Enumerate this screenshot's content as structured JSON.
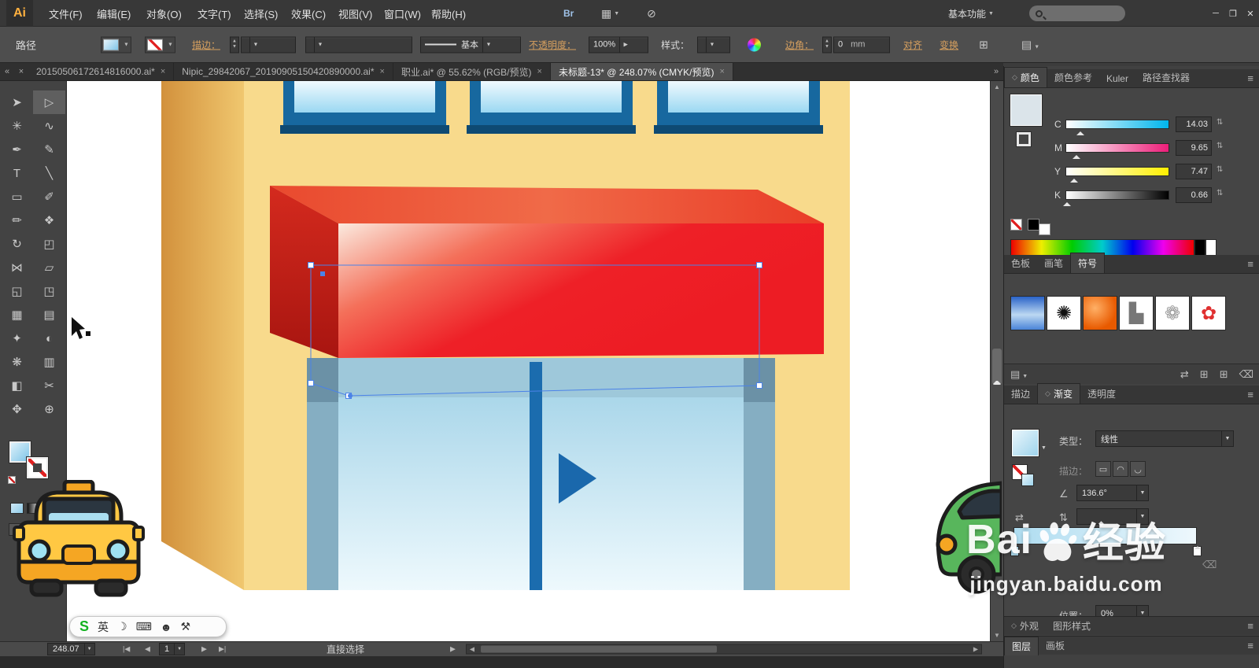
{
  "menubar": {
    "logo": "Ai",
    "items": [
      "文件(F)",
      "编辑(E)",
      "对象(O)",
      "文字(T)",
      "选择(S)",
      "效果(C)",
      "视图(V)",
      "窗口(W)",
      "帮助(H)"
    ],
    "bridge_label": "Br",
    "workspace_label": "基本功能"
  },
  "icons": {
    "dropdown": "▼",
    "close": "×",
    "menu": "≡",
    "collapse_left": "«",
    "overflow_right": "»",
    "minimize": "─",
    "restore": "❐",
    "window_close": "✕",
    "spin_up": "▲",
    "spin_down": "▼",
    "swap": "⇄",
    "angle": "∠",
    "aspect": "⇅",
    "diamond": "◆",
    "trash": "⌫",
    "library": "▤",
    "grid": "⊞",
    "gpu": "⊘",
    "arrange": "▦",
    "prev": "◀",
    "next": "▶",
    "first": "|◀",
    "last": "▶|",
    "panel_diamond": "◇"
  },
  "control_bar": {
    "selection_label": "路径",
    "stroke_link": "描边：",
    "stroke_style_value": "基本",
    "opacity_link": "不透明度：",
    "opacity_value": "100%",
    "style_label": "样式：",
    "corner_link": "边角：",
    "corner_value": "0",
    "corner_unit": "mm",
    "align_link": "对齐",
    "transform_link": "变换"
  },
  "document_tabs": [
    {
      "label": "20150506172614816000.ai*"
    },
    {
      "label": "Nipic_29842067_20190905150420890000.ai*"
    },
    {
      "label": "职业.ai* @ 55.62% (RGB/预览)"
    },
    {
      "label": "未标题-13* @ 248.07% (CMYK/预览)"
    }
  ],
  "tools": [
    {
      "name": "selection",
      "glyph": "➤"
    },
    {
      "name": "direct-selection",
      "glyph": "▷"
    },
    {
      "name": "magic-wand",
      "glyph": "✳"
    },
    {
      "name": "lasso",
      "glyph": "∿"
    },
    {
      "name": "pen",
      "glyph": "✒"
    },
    {
      "name": "curvature",
      "glyph": "✎"
    },
    {
      "name": "type",
      "glyph": "T"
    },
    {
      "name": "line-segment",
      "glyph": "╲"
    },
    {
      "name": "rectangle",
      "glyph": "▭"
    },
    {
      "name": "paintbrush",
      "glyph": "✐"
    },
    {
      "name": "pencil",
      "glyph": "✏"
    },
    {
      "name": "shaper",
      "glyph": "❖"
    },
    {
      "name": "rotate",
      "glyph": "↻"
    },
    {
      "name": "scale",
      "glyph": "◰"
    },
    {
      "name": "width",
      "glyph": "⋈"
    },
    {
      "name": "free-transform",
      "glyph": "▱"
    },
    {
      "name": "shape-builder",
      "glyph": "◱"
    },
    {
      "name": "perspective-grid",
      "glyph": "◳"
    },
    {
      "name": "mesh",
      "glyph": "▦"
    },
    {
      "name": "gradient",
      "glyph": "▤"
    },
    {
      "name": "eyedropper",
      "glyph": "✦"
    },
    {
      "name": "blend",
      "glyph": "◐"
    },
    {
      "name": "symbol-sprayer",
      "glyph": "❋"
    },
    {
      "name": "column-graph",
      "glyph": "▥"
    },
    {
      "name": "artboard",
      "glyph": "◧"
    },
    {
      "name": "slice",
      "glyph": "✂"
    },
    {
      "name": "hand",
      "glyph": "✥"
    },
    {
      "name": "zoom",
      "glyph": "⊕"
    }
  ],
  "color_panel": {
    "tabs": [
      "颜色",
      "颜色参考",
      "Kuler",
      "路径查找器"
    ],
    "channels": [
      {
        "label": "C",
        "value": "14.03"
      },
      {
        "label": "M",
        "value": "9.65"
      },
      {
        "label": "Y",
        "value": "7.47"
      },
      {
        "label": "K",
        "value": "0.66"
      }
    ]
  },
  "swatches_panel": {
    "tabs": [
      "色板",
      "画笔",
      "符号"
    ],
    "symbols": [
      {
        "name": "blue-gradient-swatch",
        "glyph": ""
      },
      {
        "name": "ink-splat-symbol",
        "glyph": "✺"
      },
      {
        "name": "orange-sphere-symbol",
        "glyph": ""
      },
      {
        "name": "chart-symbol",
        "glyph": "▙"
      },
      {
        "name": "wreath-symbol",
        "glyph": "❁"
      },
      {
        "name": "red-flower-symbol",
        "glyph": "✿"
      }
    ]
  },
  "gradient_panel": {
    "tabs": [
      "描边",
      "渐变",
      "透明度"
    ],
    "type_label": "类型：",
    "type_value": "线性",
    "stroke_label": "描边：",
    "stroke_buttons": [
      "▭",
      "◠",
      "◡"
    ],
    "angle_value": "136.6°",
    "position_label": "位置：",
    "position_value": "0%"
  },
  "collapsed_panels": {
    "appearance_tabs": [
      "外观",
      "图形样式"
    ],
    "layers_tabs": [
      "图层",
      "画板"
    ]
  },
  "status_bar": {
    "zoom_value": "248.07",
    "page_value": "1",
    "tool_status": "直接选择"
  },
  "ime_bar": {
    "logo": "S",
    "mode": "英",
    "icons": [
      "☽",
      "⌨",
      "☻",
      "⚒"
    ]
  },
  "watermark": {
    "brand_prefix": "Bai",
    "brand_suffix": "经验",
    "url": "jingyan.baidu.com"
  },
  "colors": {
    "awning_red": "#ed1c24",
    "facade_yellow": "#f8da8c",
    "side_wall_orange": "#e0a44e",
    "window_frame_blue": "#17689f",
    "door_glass_blue": "#bfe4f5",
    "door_divider_blue": "#1b6cae",
    "selection_blue": "#4b82e8",
    "taxi_yellow": "#ffc843",
    "car_green": "#58b65c"
  }
}
